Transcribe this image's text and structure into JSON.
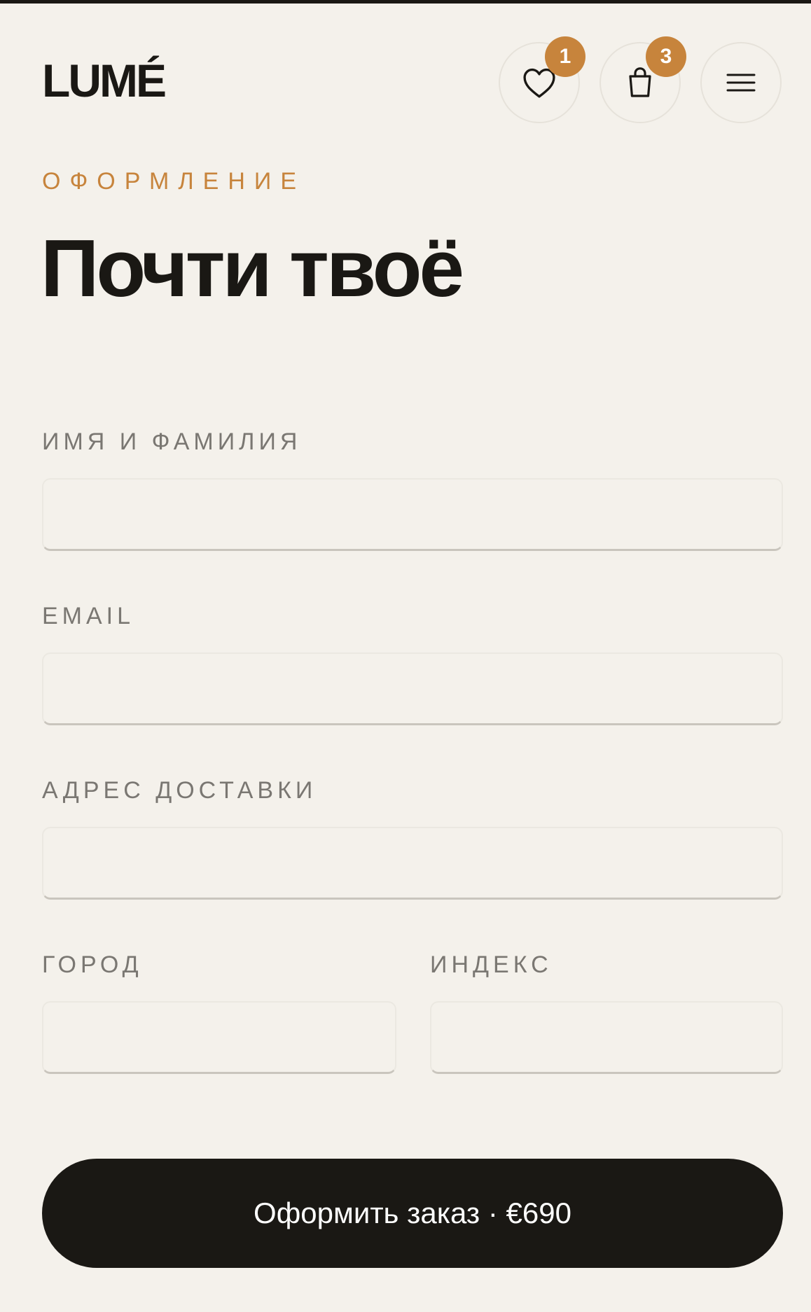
{
  "header": {
    "logo": "LUMÉ",
    "wishlist": {
      "icon": "heart-icon",
      "count": "1"
    },
    "cart": {
      "icon": "bag-icon",
      "count": "3"
    },
    "menu": {
      "icon": "hamburger-menu-icon"
    }
  },
  "checkout": {
    "eyebrow": "ОФОРМЛЕНИЕ",
    "title": "Почти твоё"
  },
  "form": {
    "fields": [
      {
        "label": "ИМЯ И ФАМИЛИЯ",
        "value": ""
      },
      {
        "label": "EMAIL",
        "value": ""
      },
      {
        "label": "АДРЕС ДОСТАВКИ",
        "value": ""
      },
      {
        "label": "ГОРОД",
        "value": ""
      },
      {
        "label": "ИНДЕКС",
        "value": ""
      }
    ],
    "submit_label": "Оформить заказ · €690"
  },
  "colors": {
    "background": "#f4f1eb",
    "accent": "#c7843c",
    "text": "#1a1814",
    "button": "#1a1814"
  }
}
